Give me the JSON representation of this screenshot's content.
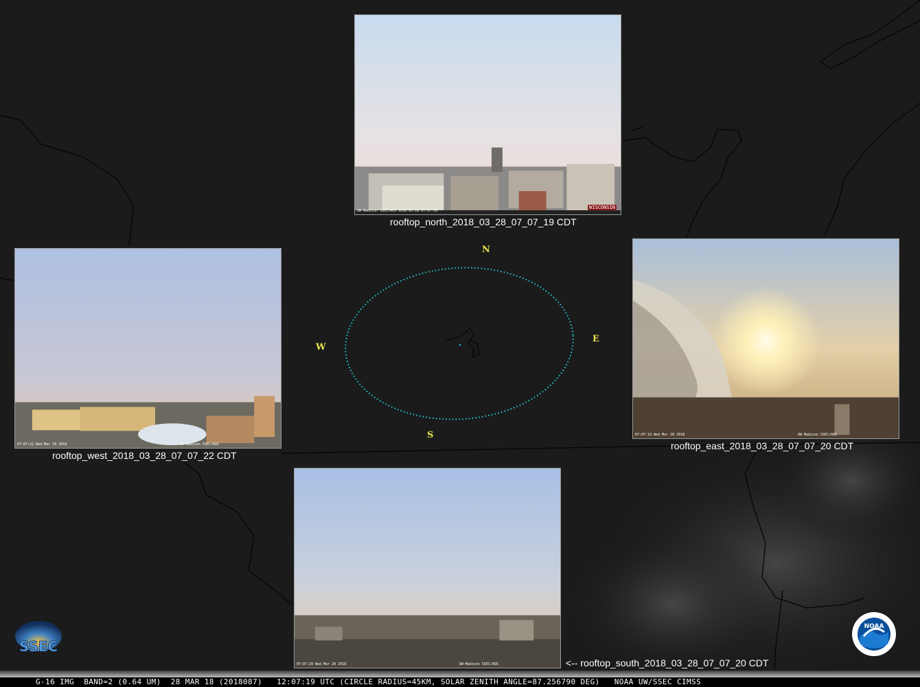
{
  "cameras": {
    "north": {
      "caption": "rooftop_north_2018_03_28_07_07_19 CDT",
      "stamp_left": "UW-Madison SSEC/AOS 2018-03-28 07:07:19",
      "stamp_right": "WISCONSIN"
    },
    "west": {
      "caption": "rooftop_west_2018_03_28_07_07_22 CDT",
      "stamp_left": "07:07:22 Wed Mar 28 2018",
      "stamp_right": "UW-Madison SSEC/AOS"
    },
    "east": {
      "caption": "rooftop_east_2018_03_28_07_07_20 CDT",
      "stamp_left": "07:07:19 Wed Mar 28 2018",
      "stamp_right": "UW-Madison SSEC/AOS"
    },
    "south": {
      "caption": "<-- rooftop_south_2018_03_28_07_07_20 CDT",
      "stamp_left": "07:07:20 Wed Mar 28 2018",
      "stamp_right": "UW-Madison SSEC/AOS"
    }
  },
  "compass": {
    "n": "N",
    "s": "S",
    "e": "E",
    "w": "W"
  },
  "status_bar": "G-16 IMG  BAND=2 (0.64 UM)  28 MAR 18 (2018087)   12:07:19 UTC (CIRCLE RADIUS=45KM, SOLAR ZENITH ANGLE=87.256790 DEG)   NOAA UW/SSEC CIMSS",
  "logos": {
    "ssec": "SSEC",
    "noaa": "NOAA"
  },
  "colors": {
    "circle": "#25c8d8",
    "compass": "#e8e24a",
    "map_bg": "#1b1b1b"
  }
}
